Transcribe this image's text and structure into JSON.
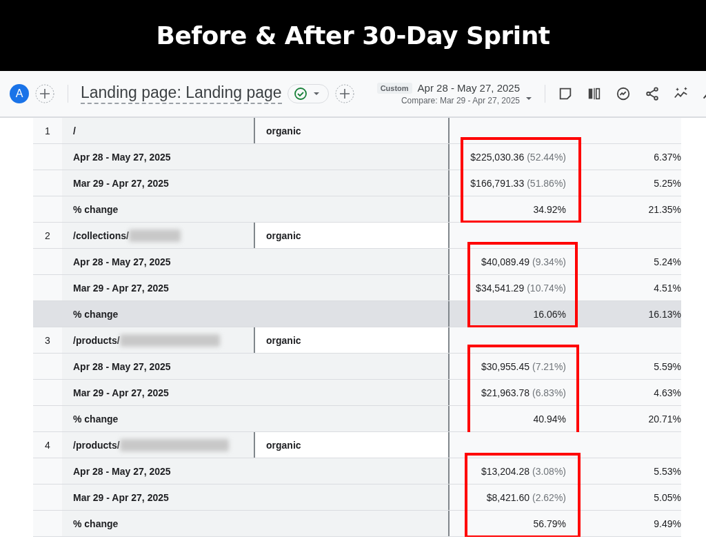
{
  "banner": {
    "title": "Before & After 30-Day Sprint"
  },
  "toolbar": {
    "avatar": "A",
    "title": "Landing page: Landing page",
    "status_ok": true,
    "date_badge": "Custom",
    "date_range": "Apr 28 - May 27, 2025",
    "compare": "Compare: Mar 29 - Apr 27, 2025"
  },
  "groups": [
    {
      "index": "1",
      "page": "/",
      "redacted": false,
      "source": "organic",
      "highlighted": true,
      "rows": [
        {
          "label": "Apr 28 - May 27, 2025",
          "revenue": "$225,030.36",
          "share": "(52.44%)",
          "rate": "6.37%",
          "hovered": false
        },
        {
          "label": "Mar 29 - Apr 27, 2025",
          "revenue": "$166,791.33",
          "share": "(51.86%)",
          "rate": "5.25%",
          "hovered": false
        },
        {
          "label": "% change",
          "revenue": "34.92%",
          "rate": "21.35%",
          "hovered": false
        }
      ]
    },
    {
      "index": "2",
      "page": "/collections/",
      "redacted": true,
      "source": "organic",
      "highlighted": true,
      "rows": [
        {
          "label": "Apr 28 - May 27, 2025",
          "revenue": "$40,089.49",
          "share": "(9.34%)",
          "rate": "5.24%",
          "hovered": false
        },
        {
          "label": "Mar 29 - Apr 27, 2025",
          "revenue": "$34,541.29",
          "share": "(10.74%)",
          "rate": "4.51%",
          "hovered": false
        },
        {
          "label": "% change",
          "revenue": "16.06%",
          "rate": "16.13%",
          "hovered": true
        }
      ]
    },
    {
      "index": "3",
      "page": "/products/",
      "redacted": true,
      "source": "organic",
      "highlighted": true,
      "rows": [
        {
          "label": "Apr 28 - May 27, 2025",
          "revenue": "$30,955.45",
          "share": "(7.21%)",
          "rate": "5.59%",
          "hovered": false
        },
        {
          "label": "Mar 29 - Apr 27, 2025",
          "revenue": "$21,963.78",
          "share": "(6.83%)",
          "rate": "4.63%",
          "hovered": false
        },
        {
          "label": "% change",
          "revenue": "40.94%",
          "rate": "20.71%",
          "hovered": false
        }
      ]
    },
    {
      "index": "4",
      "page": "/products/",
      "redacted": true,
      "source": "organic",
      "highlighted": true,
      "rows": [
        {
          "label": "Apr 28 - May 27, 2025",
          "revenue": "$13,204.28",
          "share": "(3.08%)",
          "rate": "5.53%",
          "hovered": false
        },
        {
          "label": "Mar 29 - Apr 27, 2025",
          "revenue": "$8,421.60",
          "share": "(2.62%)",
          "rate": "5.05%",
          "hovered": false
        },
        {
          "label": "% change",
          "revenue": "56.79%",
          "rate": "9.49%",
          "hovered": false
        }
      ]
    }
  ]
}
